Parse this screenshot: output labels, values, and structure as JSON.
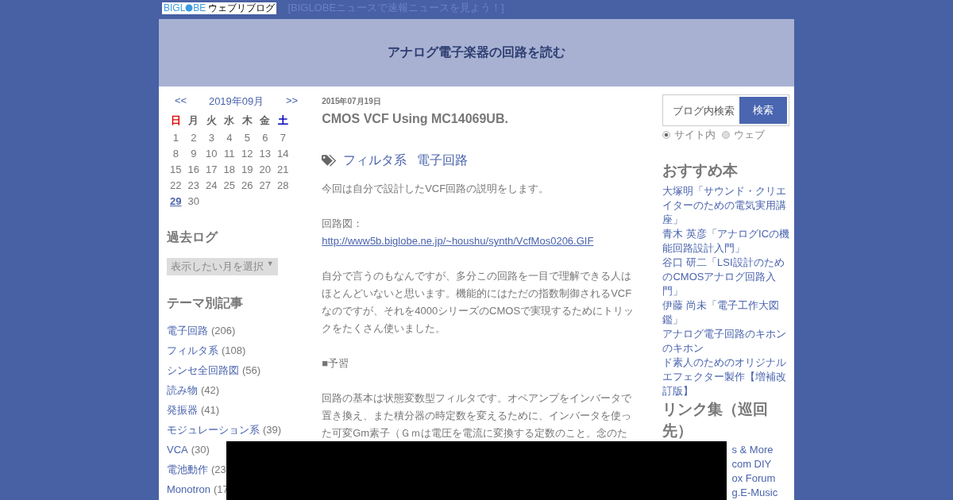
{
  "topbar": {
    "logo": {
      "before": "BIGL",
      "after": "BE",
      "service": "ウェブリブログ"
    },
    "news_link": "[BIGLOBEニュースで速報ニュースを見よう！]"
  },
  "header": {
    "title": "アナログ電子楽器の回路を読む"
  },
  "calendar": {
    "prev": "<<",
    "month": "2019年09月",
    "next": ">>",
    "weekdays": [
      {
        "label": "日",
        "color": "#dd0000"
      },
      {
        "label": "月",
        "color": "#666666"
      },
      {
        "label": "火",
        "color": "#666666"
      },
      {
        "label": "水",
        "color": "#666666"
      },
      {
        "label": "木",
        "color": "#666666"
      },
      {
        "label": "金",
        "color": "#666666"
      },
      {
        "label": "土",
        "color": "#0000bb"
      }
    ],
    "weeks": [
      [
        {
          "day": "1",
          "link": false
        },
        {
          "day": "2",
          "link": false
        },
        {
          "day": "3",
          "link": false
        },
        {
          "day": "4",
          "link": false
        },
        {
          "day": "5",
          "link": false
        },
        {
          "day": "6",
          "link": false
        },
        {
          "day": "7",
          "link": false
        }
      ],
      [
        {
          "day": "8",
          "link": false
        },
        {
          "day": "9",
          "link": false
        },
        {
          "day": "10",
          "link": false
        },
        {
          "day": "11",
          "link": false
        },
        {
          "day": "12",
          "link": false
        },
        {
          "day": "13",
          "link": false
        },
        {
          "day": "14",
          "link": false
        }
      ],
      [
        {
          "day": "15",
          "link": false
        },
        {
          "day": "16",
          "link": false
        },
        {
          "day": "17",
          "link": false
        },
        {
          "day": "18",
          "link": false
        },
        {
          "day": "19",
          "link": false
        },
        {
          "day": "20",
          "link": false
        },
        {
          "day": "21",
          "link": false
        }
      ],
      [
        {
          "day": "22",
          "link": false
        },
        {
          "day": "23",
          "link": false
        },
        {
          "day": "24",
          "link": false
        },
        {
          "day": "25",
          "link": false
        },
        {
          "day": "26",
          "link": false
        },
        {
          "day": "27",
          "link": false
        },
        {
          "day": "28",
          "link": false
        }
      ],
      [
        {
          "day": "29",
          "link": true
        },
        {
          "day": "30",
          "link": false
        }
      ]
    ]
  },
  "archive": {
    "heading": "過去ログ",
    "select": "表示したい月を選択",
    "caret": "▼"
  },
  "themes": {
    "heading": "テーマ別記事",
    "items": [
      {
        "label": "電子回路",
        "count": "(206)"
      },
      {
        "label": "フィルタ系",
        "count": "(108)"
      },
      {
        "label": "シンセ全回路図",
        "count": "(56)"
      },
      {
        "label": "読み物",
        "count": "(42)"
      },
      {
        "label": "発振器",
        "count": "(41)"
      },
      {
        "label": "モジュレーション系",
        "count": "(39)"
      },
      {
        "label": "VCA",
        "count": "(30)"
      },
      {
        "label": "電池動作",
        "count": "(23"
      },
      {
        "label": "Monotron",
        "count": "(17"
      }
    ]
  },
  "article": {
    "date": "2015年07月19日",
    "title": "CMOS VCF Using MC14069UB.",
    "tags": [
      "フィルタ系",
      "電子回路"
    ],
    "blocks": [
      {
        "kind": "text",
        "text": "今回は自分で設計したVCF回路の説明をします。"
      },
      {
        "kind": "gap"
      },
      {
        "kind": "text",
        "text": "回路図："
      },
      {
        "kind": "link",
        "text": "http://www5b.biglobe.ne.jp/~houshu/synth/VcfMos0206.GIF"
      },
      {
        "kind": "gap"
      },
      {
        "kind": "text",
        "text": "自分で言うのもなんですが、多分この回路を一目で理解できる人はほとんどいないと思います。機能的にはただの指数制御されるVCFなのですが、それを4000シリーズのCMOSで実現するためにトリックをたくさん使いました。"
      },
      {
        "kind": "gap"
      },
      {
        "kind": "text",
        "text": "■予習"
      },
      {
        "kind": "gap"
      },
      {
        "kind": "text",
        "text": "回路の基本は状態変数型フィルタです。オペアンプをインバータで置き換え、また積分器の時定数を変えるために、インバータを使った可変Gm素子（Ｇｍは電圧を電流に変換する定数のこと。念のた"
      }
    ]
  },
  "search": {
    "placeholder": "ブログ内検索",
    "button": "検索",
    "scopes": [
      {
        "label": "サイト内",
        "selected": true
      },
      {
        "label": "ウェブ",
        "selected": false
      }
    ]
  },
  "books": {
    "heading": "おすすめ本",
    "items": [
      "大塚明「サウンド・クリエイターのための電気実用講座」",
      "青木 英彦「アナログICの機能回路設計入門」",
      "谷口 研二「LSI設計のためのCMOSアナログ回路入門」",
      "伊藤 尚未「電子工作大図鑑」",
      "アナログ電子回路のキホンのキホン",
      "ド素人のためのオリジナルエフェクター製作【増補改訂版】"
    ]
  },
  "links": {
    "heading": "リンク集（巡回先）",
    "items": [
      "s & More",
      "com DIY",
      "ox Forum",
      "g.E-Music"
    ]
  }
}
